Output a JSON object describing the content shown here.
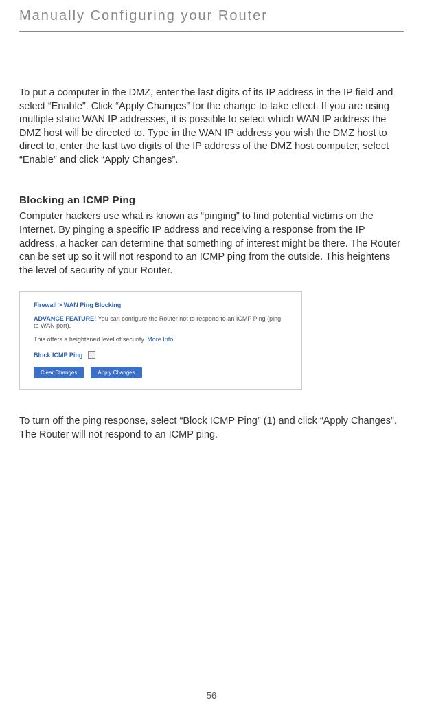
{
  "header": {
    "title": "Manually Configuring your Router"
  },
  "content": {
    "para1": "To put a computer in the DMZ, enter the last digits of its IP address in the IP field and select “Enable”. Click “Apply Changes” for the change to take effect. If you are using multiple static WAN IP addresses, it is possible to select which WAN IP address the DMZ host will be directed to. Type in the WAN IP address you wish the DMZ host to direct to, enter the last two digits of the IP address of the DMZ host computer, select “Enable” and click “Apply Changes”.",
    "section_heading": "Blocking an ICMP Ping",
    "para2": "Computer hackers use what is known as “pinging” to find potential victims on the Internet. By pinging a specific IP address and receiving a response from the IP address, a hacker can determine that something of interest might be there. The Router can be set up so it will not respond to an ICMP ping from the outside. This heightens the level of security of your Router.",
    "screenshot": {
      "breadcrumb": "Firewall > WAN Ping Blocking",
      "advance_label": "ADVANCE FEATURE!",
      "advance_text": " You can configure the Router not to respond to an ICMP Ping (ping to WAN port).",
      "security_note": "This offers a heightened level of security. ",
      "more_info": "More Info",
      "block_label": "Block ICMP Ping",
      "clear_btn": "Clear Changes",
      "apply_btn": "Apply Changes"
    },
    "para3": "To turn off the ping response, select “Block ICMP Ping” (1) and click “Apply Changes”. The Router will not respond to an ICMP ping."
  },
  "page_number": "56"
}
